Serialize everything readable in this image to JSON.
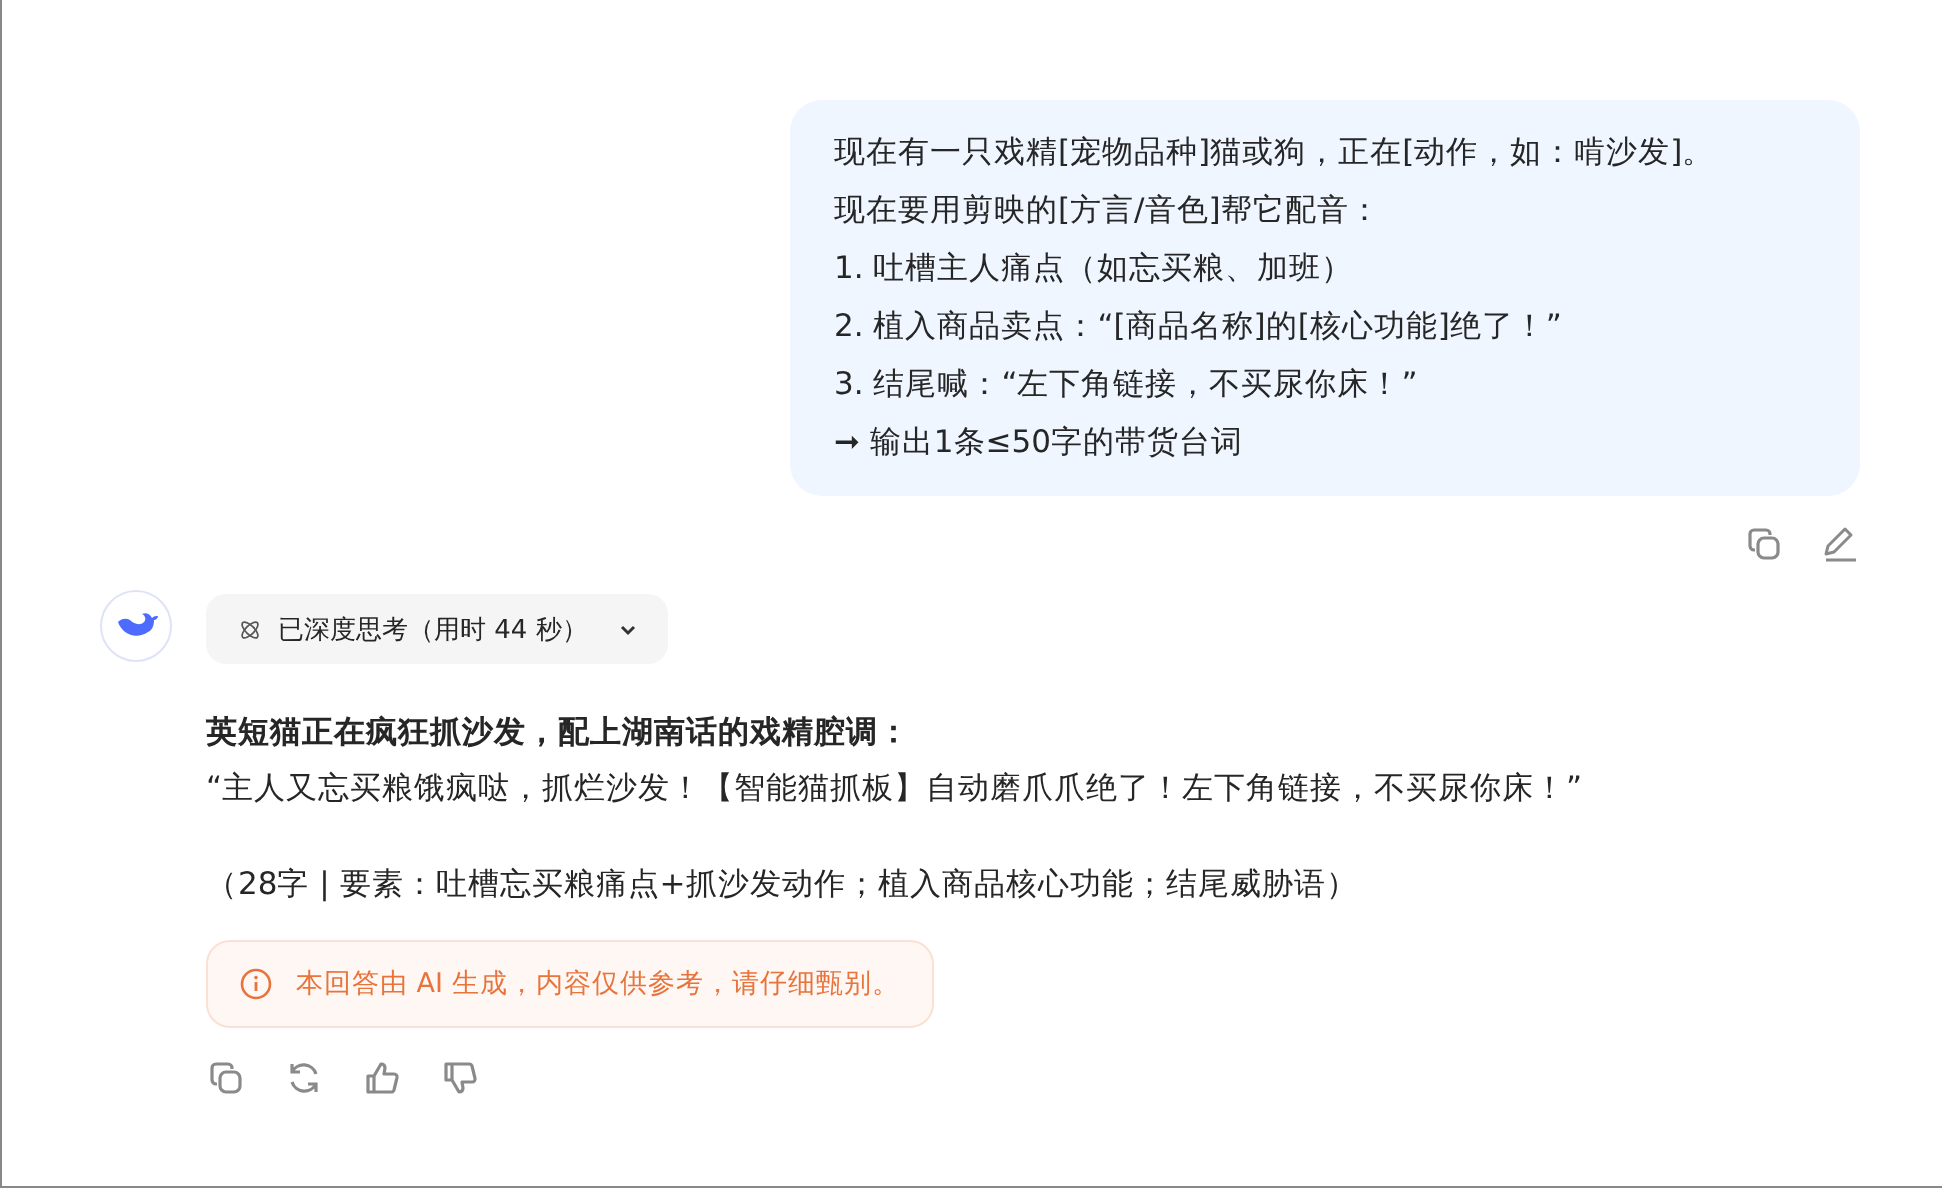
{
  "user_message": {
    "lines": [
      "现在有一只戏精[宠物品种]猫或狗，正在[动作，如：啃沙发]。",
      "现在要用剪映的[方言/音色]帮它配音：",
      "1. 吐槽主人痛点（如忘买粮、加班）",
      "2. 植入商品卖点：“[商品名称]的[核心功能]绝了！”",
      "3. 结尾喊：“左下角链接，不买尿你床！”",
      "➞ 输出1条≤50字的带货台词"
    ]
  },
  "thinking": {
    "label": "已深度思考（用时 44 秒）",
    "expanded": false
  },
  "answer": {
    "heading": "英短猫正在疯狂抓沙发，配上湖南话的戏精腔调：",
    "quote": "“主人又忘买粮饿疯哒，抓烂沙发！【智能猫抓板】自动磨爪爪绝了！左下角链接，不买尿你床！”",
    "note": "（28字 | 要素：吐槽忘买粮痛点+抓沙发动作；植入商品核心功能；结尾威胁语）"
  },
  "disclaimer": "本回答由 AI 生成，内容仅供参考，请仔细甄别。"
}
